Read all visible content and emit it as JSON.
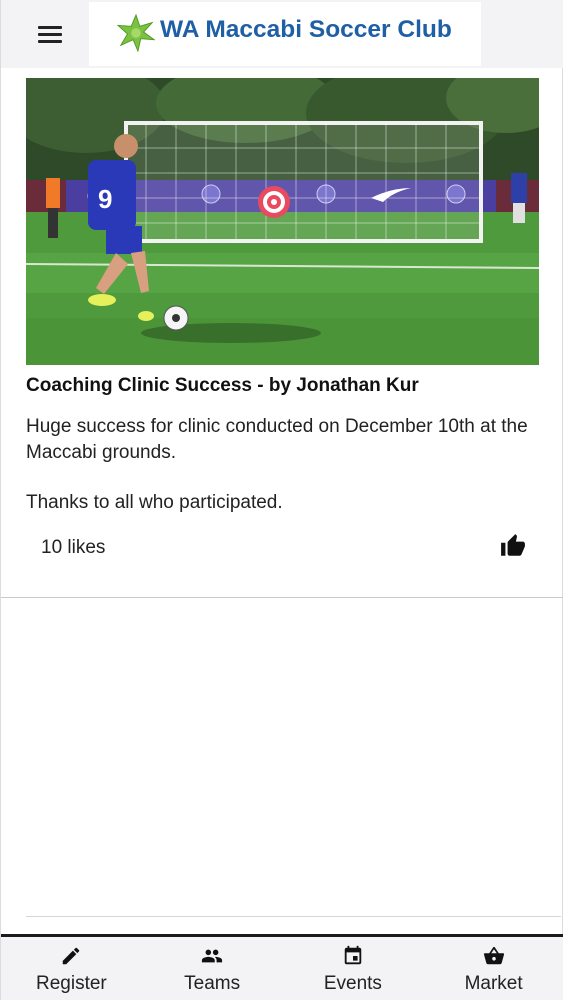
{
  "header": {
    "menu_icon": "hamburger-menu-icon",
    "logo_icon": "club-star-logo",
    "title": "WA Maccabi Soccer Club",
    "brand_color": "#1f5fa6"
  },
  "post": {
    "image_description_icon": "soccer-penalty-photo",
    "title": "Coaching Clinic Success - by Jonathan Kur",
    "paragraphs": [
      "Huge success for clinic conducted on December 10th at the Maccabi grounds.",
      "Thanks to all who participated."
    ],
    "likes_text": "10 likes",
    "like_icon": "thumbs-up-icon"
  },
  "nav": {
    "items": [
      {
        "label": "Register",
        "icon": "pencil-icon"
      },
      {
        "label": "Teams",
        "icon": "people-icon"
      },
      {
        "label": "Events",
        "icon": "calendar-icon"
      },
      {
        "label": "Market",
        "icon": "basket-icon"
      }
    ]
  }
}
